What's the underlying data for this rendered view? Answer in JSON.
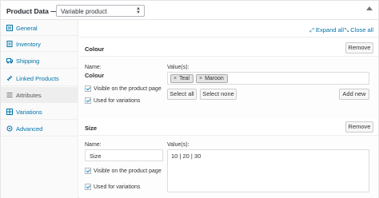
{
  "header": {
    "title": "Product Data —",
    "product_type": "Variable product"
  },
  "sidebar": {
    "items": [
      {
        "label": "General",
        "icon": "wrench-icon"
      },
      {
        "label": "Inventory",
        "icon": "clipboard-icon"
      },
      {
        "label": "Shipping",
        "icon": "truck-icon"
      },
      {
        "label": "Linked Products",
        "icon": "link-icon"
      },
      {
        "label": "Attributes",
        "icon": "list-icon"
      },
      {
        "label": "Variations",
        "icon": "grid-icon"
      },
      {
        "label": "Advanced",
        "icon": "gear-icon"
      }
    ],
    "active": "Attributes"
  },
  "toolbar": {
    "expand_all": "Expand all",
    "close_all": "Close all"
  },
  "attributes": [
    {
      "title": "Colour",
      "remove_label": "Remove",
      "name_label": "Name:",
      "name_value": "Colour",
      "values_label": "Value(s):",
      "values": [
        "Teal",
        "Maroon"
      ],
      "visible_label": "Visible on the product page",
      "variations_label": "Used for variations",
      "select_all": "Select all",
      "select_none": "Select none",
      "add_new": "Add new"
    },
    {
      "title": "Size",
      "remove_label": "Remove",
      "name_label": "Name:",
      "name_value": "Size",
      "values_label": "Value(s):",
      "values_text": "10 | 20 | 30",
      "visible_label": "Visible on the product page",
      "variations_label": "Used for variations"
    }
  ],
  "colors": {
    "link": "#0073aa",
    "sidebar_bg": "#fafafa",
    "active_bg": "#eeeeee"
  }
}
